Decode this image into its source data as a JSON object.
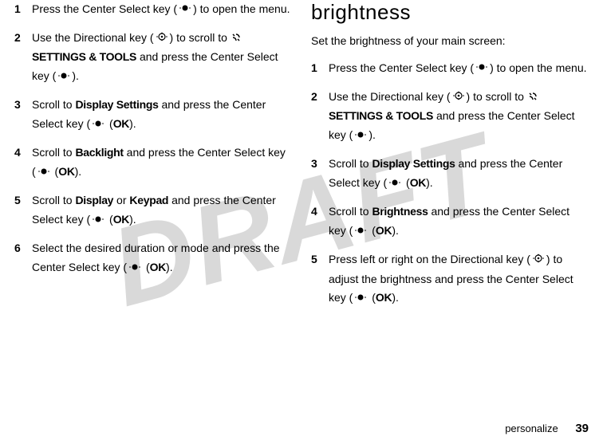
{
  "watermark": "DRAFT",
  "left": {
    "steps": [
      {
        "n": "1",
        "pre": "Press the Center Select key (",
        "icon": "center",
        "post": ") to open the menu."
      },
      {
        "n": "2",
        "pre": "Use the Directional key (",
        "icon": "dir",
        "mid": ") to scroll to ",
        "tool_icon": true,
        "tool": "SETTINGS & TOOLS",
        "post2": " and press the Center Select key (",
        "icon2": "center",
        "end": ")."
      },
      {
        "n": "3",
        "pre": "Scroll to ",
        "bold": "Display Settings",
        "mid": " and press the Center Select key (",
        "icon": "center",
        "ok": "OK",
        "end": ")."
      },
      {
        "n": "4",
        "pre": "Scroll to ",
        "bold": "Backlight",
        "mid": " and press the Center Select key (",
        "icon": "center",
        "ok": "OK",
        "end": ")."
      },
      {
        "n": "5",
        "pre": "Scroll to ",
        "bold": "Display",
        "or": " or ",
        "bold2": "Keypad",
        "mid": " and press the Center Select key (",
        "icon": "center",
        "ok": "OK",
        "end": ")."
      },
      {
        "n": "6",
        "pre": "Select the desired duration or mode and press the Center Select key (",
        "icon": "center",
        "ok": "OK",
        "end": ")."
      }
    ]
  },
  "right": {
    "heading": "brightness",
    "intro": "Set the brightness of your main screen:",
    "steps": [
      {
        "n": "1",
        "pre": "Press the Center Select key (",
        "icon": "center",
        "post": ") to open the menu."
      },
      {
        "n": "2",
        "pre": "Use the Directional key (",
        "icon": "dir",
        "mid": ") to scroll to ",
        "tool_icon": true,
        "tool": "SETTINGS & TOOLS",
        "post2": " and press the Center Select key (",
        "icon2": "center",
        "end": ")."
      },
      {
        "n": "3",
        "pre": "Scroll to ",
        "bold": "Display Settings",
        "mid": " and press the Center Select key (",
        "icon": "center",
        "ok": "OK",
        "end": ")."
      },
      {
        "n": "4",
        "pre": "Scroll to ",
        "bold": "Brightness",
        "mid": " and press the Center Select key (",
        "icon": "center",
        "ok": "OK",
        "end": ")."
      },
      {
        "n": "5",
        "pre": "Press left or right on the Directional key (",
        "icon": "dir",
        "mid2": ") to adjust the brightness and press the Center Select key (",
        "icon2": "center",
        "ok": "OK",
        "end": ")."
      }
    ]
  },
  "footer": {
    "section": "personalize",
    "page": "39"
  }
}
